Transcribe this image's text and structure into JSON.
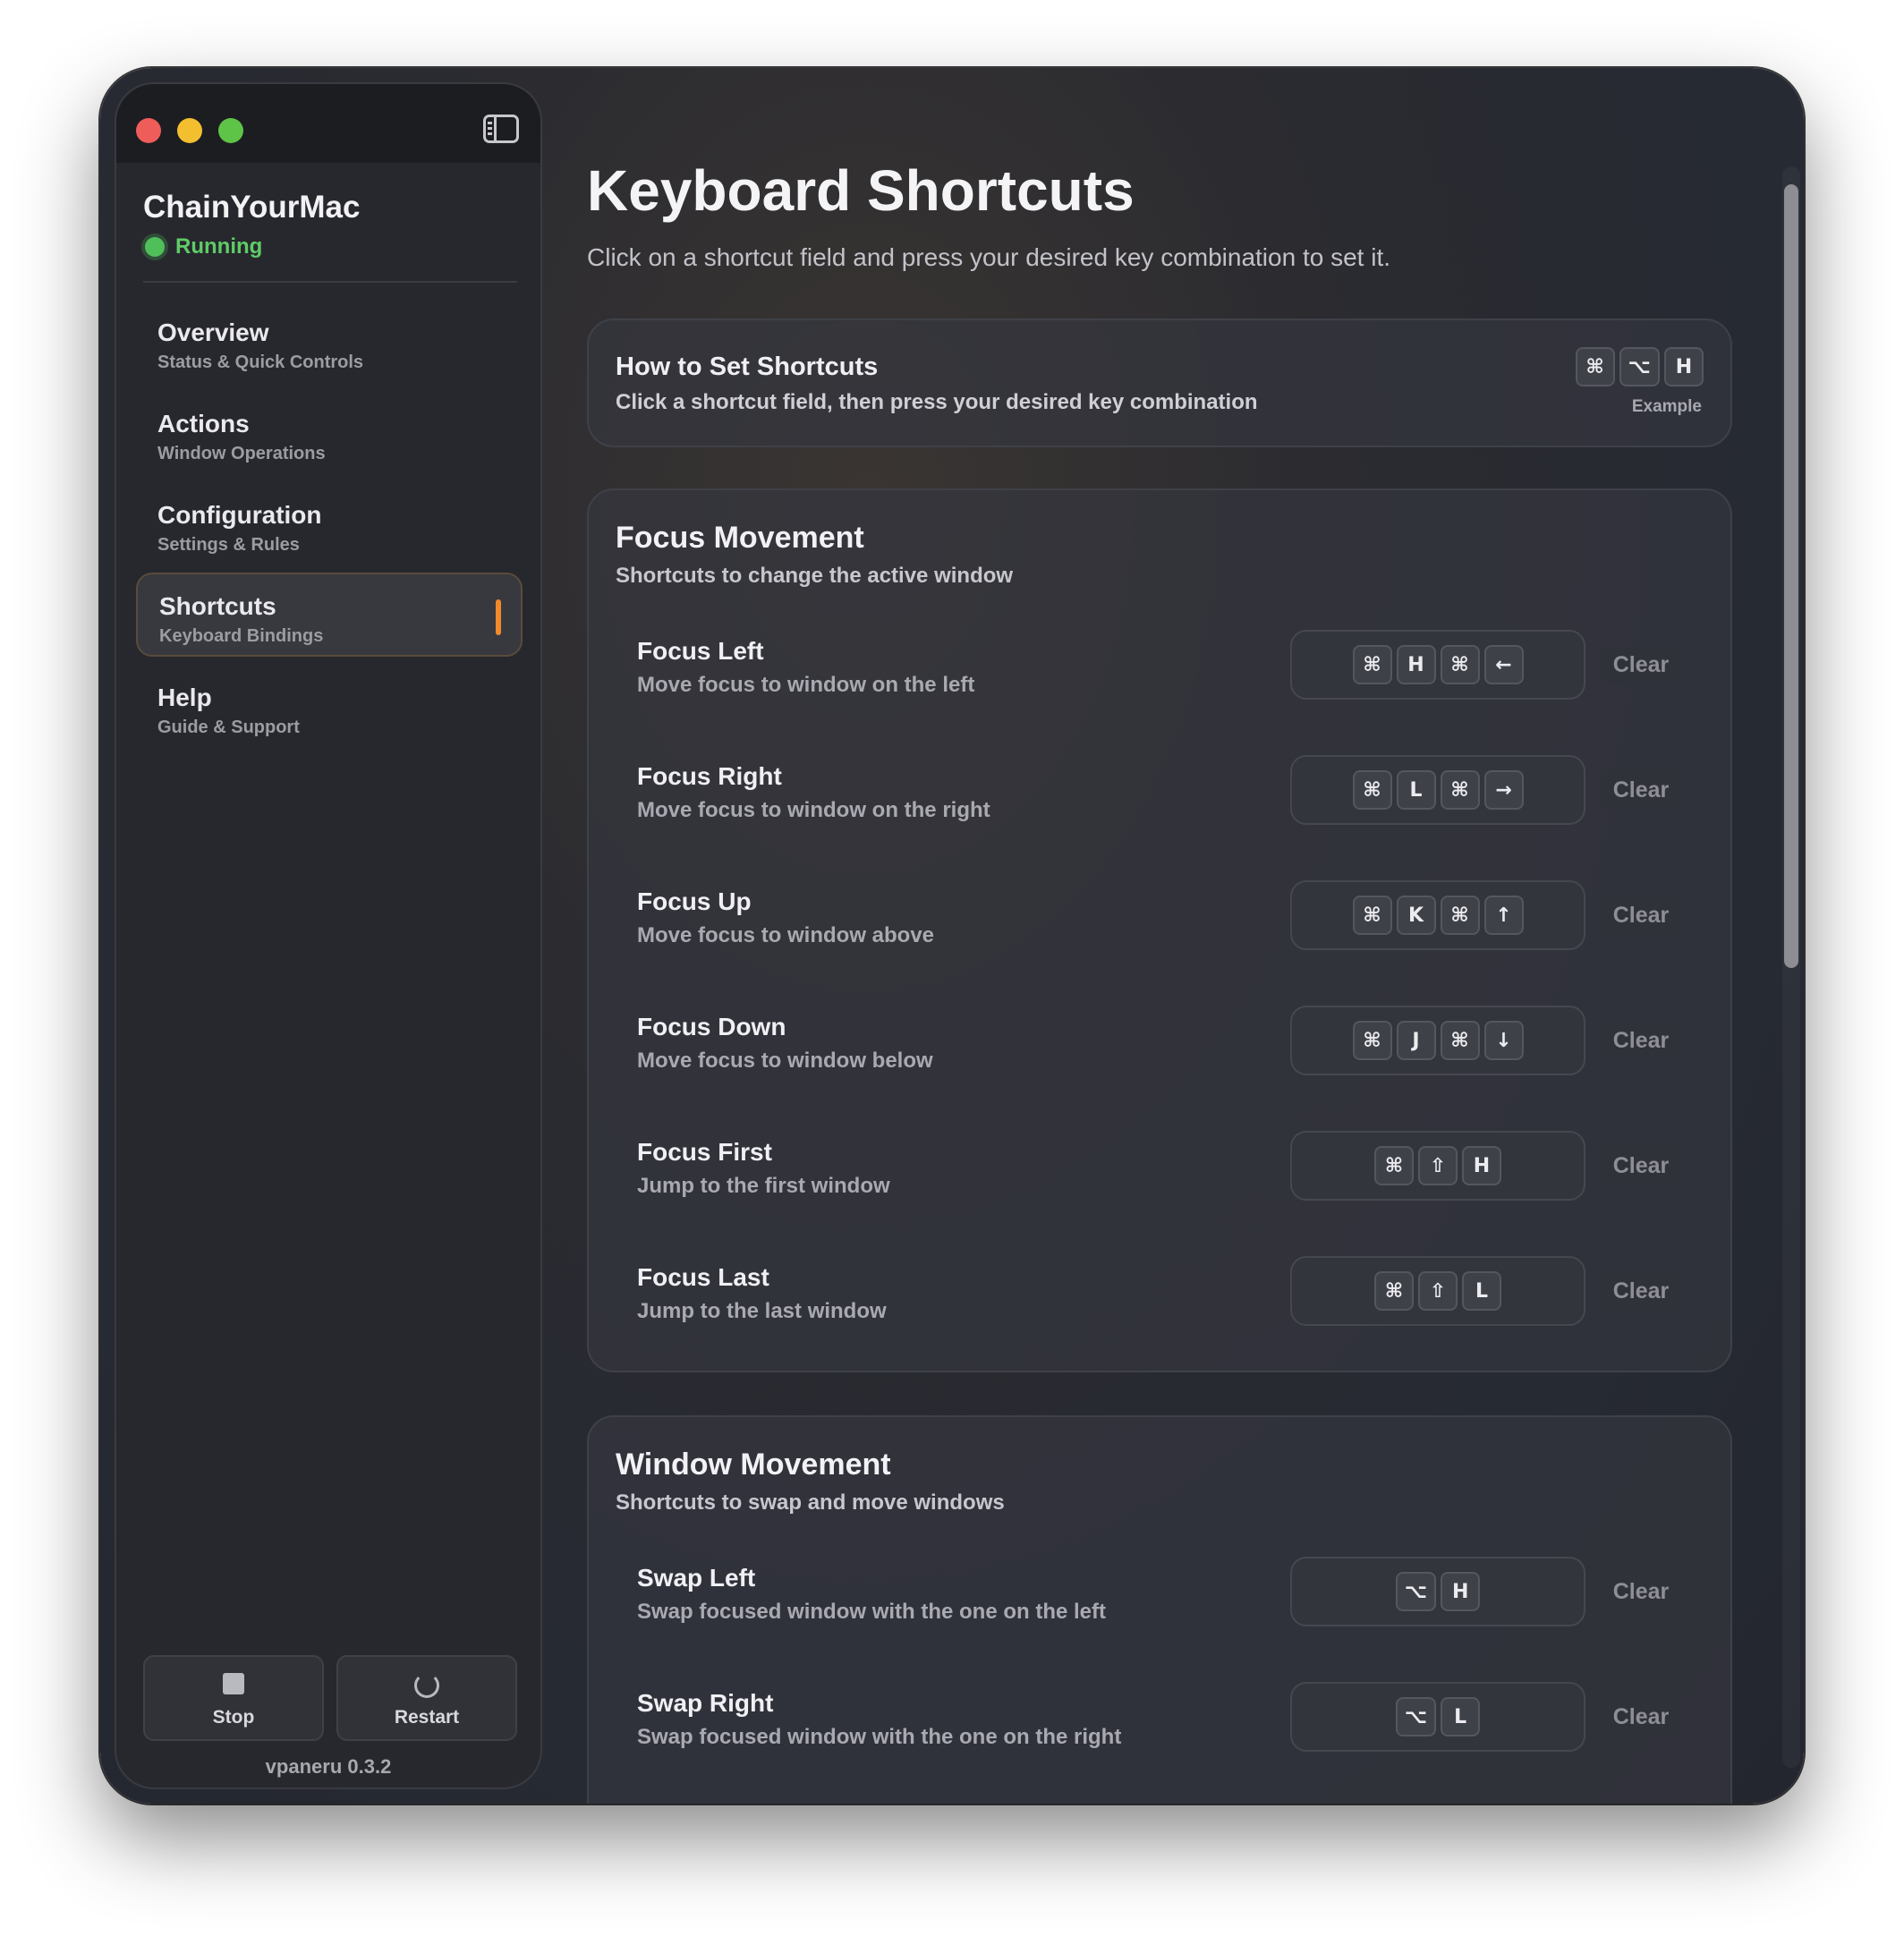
{
  "app": {
    "name": "ChainYourMac",
    "status": "Running",
    "version": "vpaneru 0.3.2"
  },
  "sidebar": {
    "items": [
      {
        "label": "Overview",
        "sub": "Status & Quick Controls"
      },
      {
        "label": "Actions",
        "sub": "Window Operations"
      },
      {
        "label": "Configuration",
        "sub": "Settings & Rules"
      },
      {
        "label": "Shortcuts",
        "sub": "Keyboard Bindings",
        "active": true
      },
      {
        "label": "Help",
        "sub": "Guide & Support"
      }
    ],
    "stop_label": "Stop",
    "restart_label": "Restart"
  },
  "page": {
    "title": "Keyboard Shortcuts",
    "subtitle": "Click on a shortcut field and press your desired key combination to set it."
  },
  "how_to": {
    "title": "How to Set Shortcuts",
    "description": "Click a shortcut field, then press your desired key combination",
    "example_keys": [
      "⌘",
      "⌥",
      "H"
    ],
    "example_label": "Example"
  },
  "sections": [
    {
      "title": "Focus Movement",
      "subtitle": "Shortcuts to change the active window",
      "rows": [
        {
          "title": "Focus Left",
          "desc": "Move focus to window on the left",
          "keys": [
            "⌘",
            "H",
            "⌘",
            "←"
          ],
          "clear": "Clear"
        },
        {
          "title": "Focus Right",
          "desc": "Move focus to window on the right",
          "keys": [
            "⌘",
            "L",
            "⌘",
            "→"
          ],
          "clear": "Clear"
        },
        {
          "title": "Focus Up",
          "desc": "Move focus to window above",
          "keys": [
            "⌘",
            "K",
            "⌘",
            "↑"
          ],
          "clear": "Clear"
        },
        {
          "title": "Focus Down",
          "desc": "Move focus to window below",
          "keys": [
            "⌘",
            "J",
            "⌘",
            "↓"
          ],
          "clear": "Clear"
        },
        {
          "title": "Focus First",
          "desc": "Jump to the first window",
          "keys": [
            "⌘",
            "⇧",
            "H"
          ],
          "clear": "Clear"
        },
        {
          "title": "Focus Last",
          "desc": "Jump to the last window",
          "keys": [
            "⌘",
            "⇧",
            "L"
          ],
          "clear": "Clear"
        }
      ]
    },
    {
      "title": "Window Movement",
      "subtitle": "Shortcuts to swap and move windows",
      "rows": [
        {
          "title": "Swap Left",
          "desc": "Swap focused window with the one on the left",
          "keys": [
            "⌥",
            "H"
          ],
          "clear": "Clear"
        },
        {
          "title": "Swap Right",
          "desc": "Swap focused window with the one on the right",
          "keys": [
            "⌥",
            "L"
          ],
          "clear": "Clear"
        }
      ]
    }
  ],
  "colors": {
    "accent": "#f08a2c",
    "status_green": "#5fcc67"
  },
  "icons": {
    "sidebar_toggle": "sidebar-toggle-icon",
    "stop": "stop-icon",
    "restart": "restart-icon"
  }
}
